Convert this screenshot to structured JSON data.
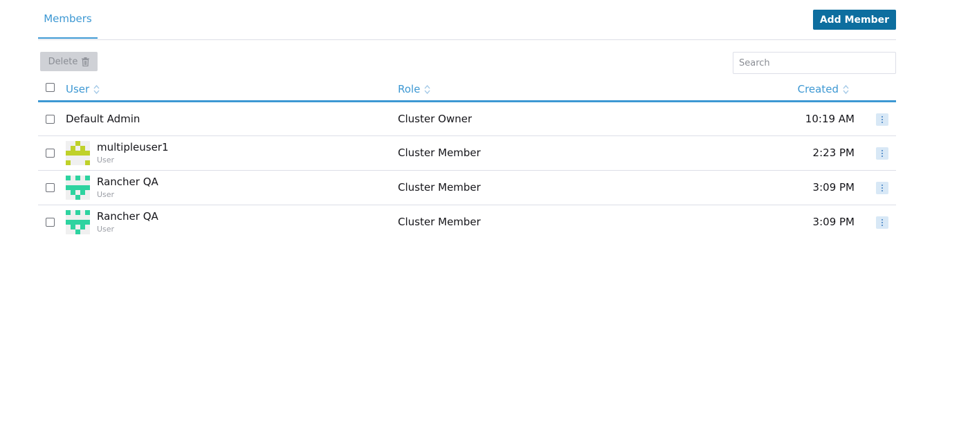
{
  "tabs": {
    "members_label": "Members"
  },
  "header": {
    "add_member_label": "Add Member"
  },
  "toolbar": {
    "delete_label": "Delete",
    "search_placeholder": "Search"
  },
  "table": {
    "columns": {
      "user": "User",
      "role": "Role",
      "created": "Created"
    },
    "rows": [
      {
        "name": "Default Admin",
        "type": "",
        "role": "Cluster Owner",
        "created": "10:19 AM",
        "avatar": "none"
      },
      {
        "name": "multipleuser1",
        "type": "User",
        "role": "Cluster Member",
        "created": "2:23 PM",
        "avatar": "identicon-lime"
      },
      {
        "name": "Rancher QA",
        "type": "User",
        "role": "Cluster Member",
        "created": "3:09 PM",
        "avatar": "identicon-teal"
      },
      {
        "name": "Rancher QA",
        "type": "User",
        "role": "Cluster Member",
        "created": "3:09 PM",
        "avatar": "identicon-teal"
      }
    ]
  },
  "colors": {
    "accent": "#3d98d3",
    "button": "#0d6e9f",
    "avatar_lime": "#bfd12a",
    "avatar_teal": "#2ed3a0"
  }
}
